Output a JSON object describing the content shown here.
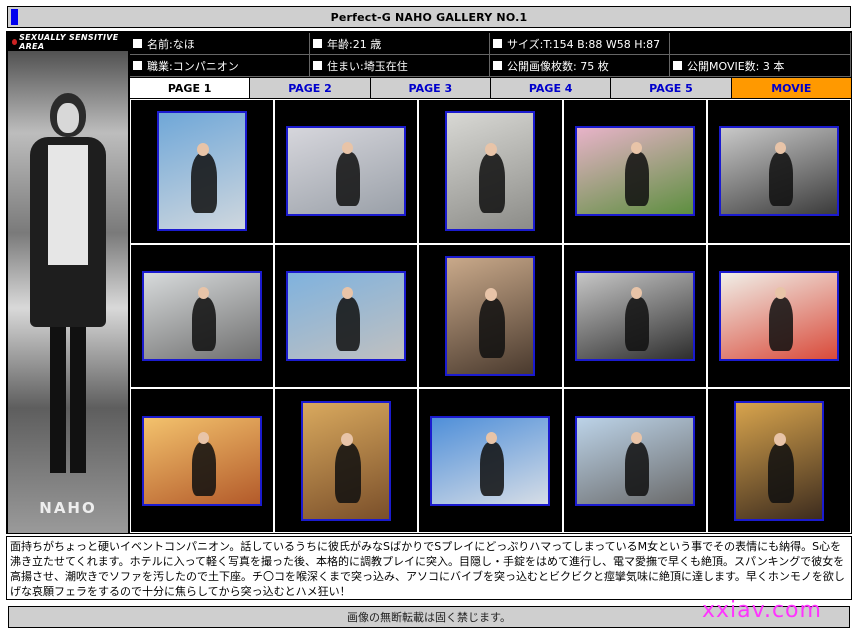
{
  "page": {
    "title": "Perfect-G NAHO GALLERY NO.1"
  },
  "portrait": {
    "logo_text": "SEXUALLY SENSITIVE AREA",
    "watermark_text": "NAHO"
  },
  "info": {
    "name": "名前:なほ",
    "age": "年齢:21 歳",
    "size": "サイズ:T:154 B:88 W58 H:87",
    "empty": "",
    "job": "職業:コンパニオン",
    "residence": "住まい:埼玉在住",
    "image_count": "公開画像枚数: 75 枚",
    "movie_count": "公開MOVIE数: 3 本"
  },
  "tabs": [
    {
      "label": "PAGE 1",
      "active": true
    },
    {
      "label": "PAGE 2",
      "active": false
    },
    {
      "label": "PAGE 3",
      "active": false
    },
    {
      "label": "PAGE 4",
      "active": false
    },
    {
      "label": "PAGE 5",
      "active": false
    },
    {
      "label": "MOVIE",
      "active": false
    }
  ],
  "gallery": {
    "thumbnails": [
      {
        "orientation": "portrait",
        "bg": [
          "#6fa7d8",
          "#cfd7de"
        ]
      },
      {
        "orientation": "landscape",
        "bg": [
          "#d6d6dc",
          "#9aa0a8"
        ]
      },
      {
        "orientation": "portrait",
        "bg": [
          "#d8d8d4",
          "#8c8c88"
        ]
      },
      {
        "orientation": "landscape",
        "bg": [
          "#e8b3c9",
          "#5d8f3f"
        ]
      },
      {
        "orientation": "landscape",
        "bg": [
          "#c9c9c9",
          "#3b3b3b"
        ]
      },
      {
        "orientation": "landscape",
        "bg": [
          "#d7dadb",
          "#6f6f6f"
        ]
      },
      {
        "orientation": "landscape",
        "bg": [
          "#7fb2de",
          "#c0c0c0"
        ]
      },
      {
        "orientation": "portrait",
        "bg": [
          "#c9a98a",
          "#4a3a2e"
        ]
      },
      {
        "orientation": "landscape",
        "bg": [
          "#c6c6c6",
          "#2e2e2e"
        ]
      },
      {
        "orientation": "landscape",
        "bg": [
          "#f0efe8",
          "#d94a3a"
        ]
      },
      {
        "orientation": "landscape",
        "bg": [
          "#f3c26d",
          "#b35a2a"
        ]
      },
      {
        "orientation": "portrait",
        "bg": [
          "#d9a95e",
          "#7a4f2a"
        ]
      },
      {
        "orientation": "landscape",
        "bg": [
          "#4f8fd9",
          "#d6dde6"
        ]
      },
      {
        "orientation": "landscape",
        "bg": [
          "#bcd3e8",
          "#6a6a6a"
        ]
      },
      {
        "orientation": "portrait",
        "bg": [
          "#d8a44d",
          "#3d2c1e"
        ]
      }
    ]
  },
  "description": {
    "text": "面持ちがちょっと硬いイベントコンパニオン。話しているうちに彼氏がみなSばかりでSプレイにどっぷりハマってしまっているM女という事でその表情にも納得。S心を沸き立たせてくれます。ホテルに入って軽く写真を撮った後、本格的に調教プレイに突入。目隠し・手錠をはめて進行し、電マ愛撫で早くも絶頂。スパンキングで彼女を高揚させ、潮吹きでソファを汚したので土下座。チ〇コを喉深くまで突っ込み、アソコにバイブを突っ込むとビクビクと痙攣気味に絶頂に達します。早くホンモノを欲しげな哀願フェラをするので十分に焦らしてから突っ込むとハメ狂い！"
  },
  "footer": {
    "notice": "画像の無断転載は固く禁じます。"
  },
  "site_watermark": "xxiav.com",
  "colors": {
    "accent_blue": "#0000ee",
    "tab_bg": "#cfcfcf",
    "movie_tab": "#ff9900",
    "thumb_border": "#1b1bcf",
    "watermark": "#ff33ff"
  }
}
